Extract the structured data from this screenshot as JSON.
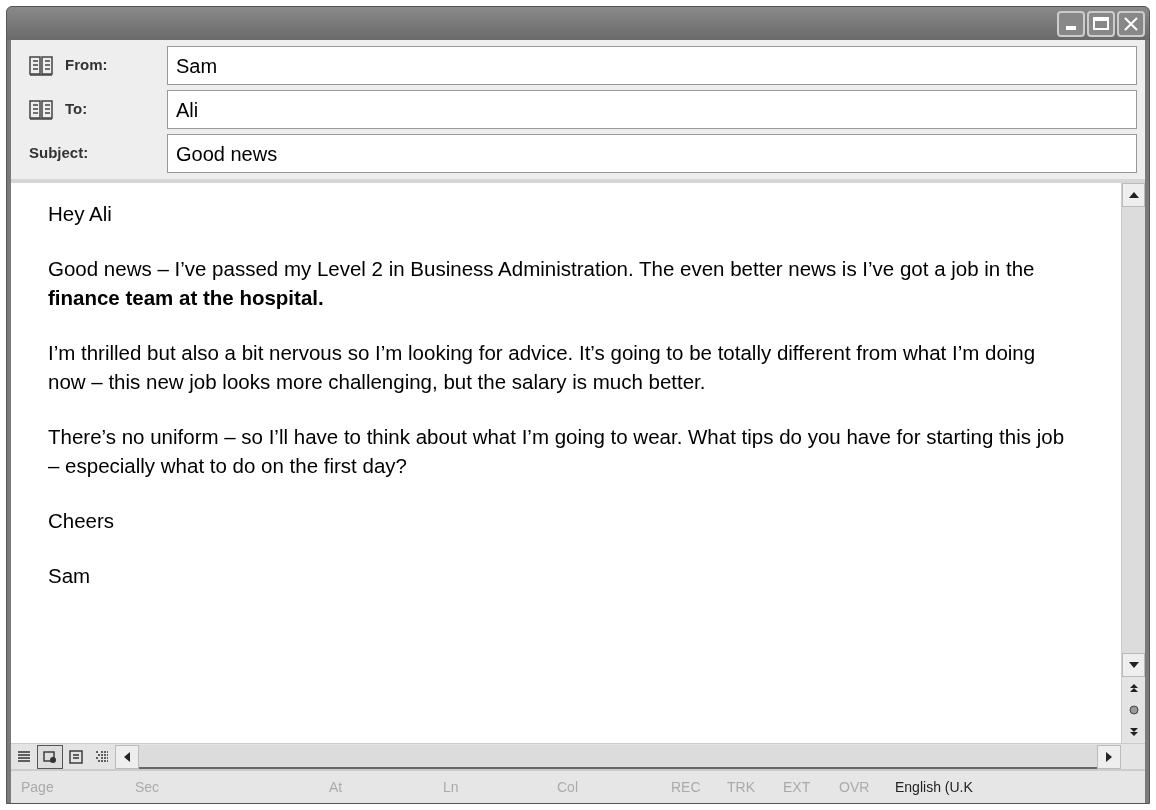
{
  "header": {
    "fields": [
      {
        "kind": "address",
        "label": "From:",
        "value": "Sam"
      },
      {
        "kind": "address",
        "label": "To:",
        "value": "Ali"
      },
      {
        "kind": "plain",
        "label": "Subject:",
        "value": "Good news"
      }
    ]
  },
  "body": {
    "paragraphs": [
      "Hey Ali",
      "Good news – I’ve passed my Level 2 in Business Administration. The even better news is I’ve got a job in the **finance team at the hospital.**",
      "I’m thrilled but also a bit nervous so I’m looking for advice. It’s going to be totally different from what I’m doing now – this new job looks more challenging, but the salary is much better.",
      "There’s no uniform – so I’ll have to think about what I’m going to wear. What tips do you have for starting this job – especially what to do on the first day?",
      "Cheers",
      "Sam"
    ]
  },
  "view_buttons": [
    {
      "kind": "normal",
      "selected": false
    },
    {
      "kind": "web",
      "selected": true
    },
    {
      "kind": "print",
      "selected": false
    },
    {
      "kind": "outline",
      "selected": false
    }
  ],
  "status_bar": [
    {
      "text": "Page",
      "disabled": true
    },
    {
      "text": "Sec",
      "disabled": true
    },
    {
      "text": "At",
      "disabled": true
    },
    {
      "text": "Ln",
      "disabled": true
    },
    {
      "text": "Col",
      "disabled": true
    },
    {
      "text": "REC",
      "disabled": true
    },
    {
      "text": "TRK",
      "disabled": true
    },
    {
      "text": "EXT",
      "disabled": true
    },
    {
      "text": "OVR",
      "disabled": true
    },
    {
      "text": "English (U.K",
      "disabled": false
    }
  ]
}
